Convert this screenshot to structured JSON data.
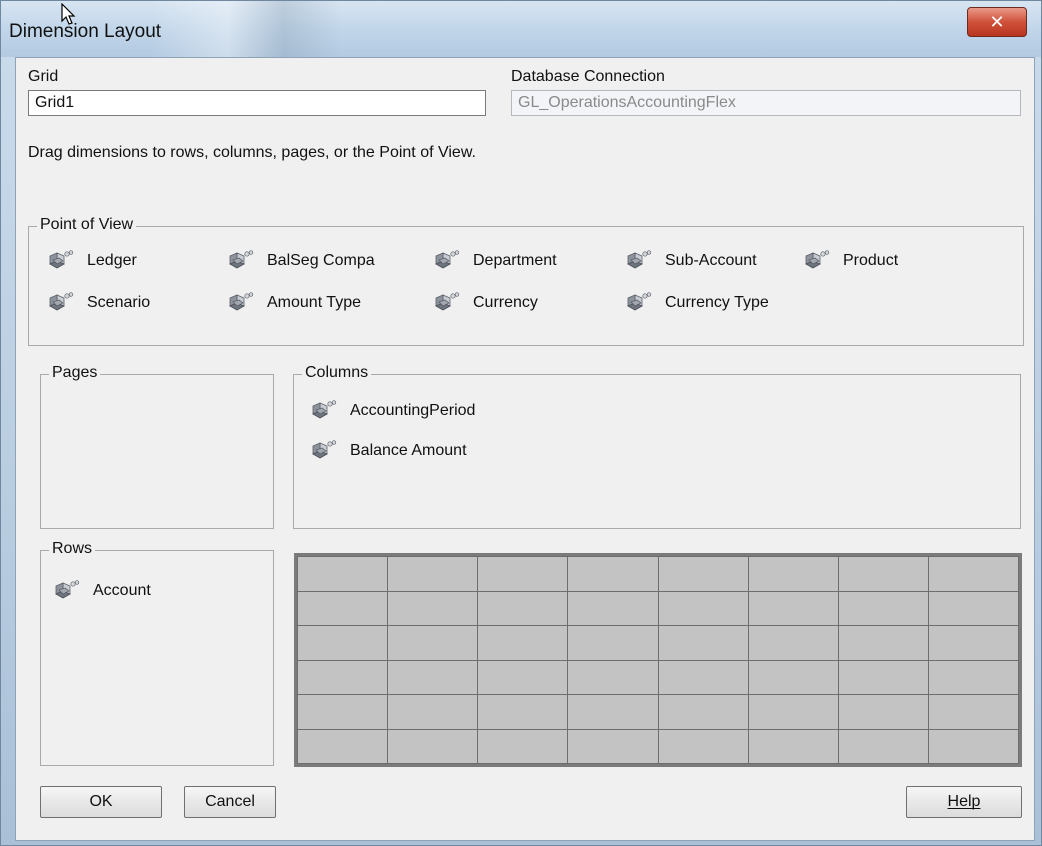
{
  "window": {
    "title": "Dimension Layout",
    "close_glyph": "✕"
  },
  "grid": {
    "label": "Grid",
    "value": "Grid1"
  },
  "database": {
    "label": "Database Connection",
    "value": "GL_OperationsAccountingFlex"
  },
  "instructions": "Drag dimensions to rows, columns, pages, or the Point of View.",
  "point_of_view": {
    "title": "Point of View",
    "items": [
      {
        "label": "Ledger",
        "icon": "dimension-cube-icon"
      },
      {
        "label": "BalSeg Compa",
        "icon": "dimension-cube-icon"
      },
      {
        "label": "Department",
        "icon": "dimension-cube-icon"
      },
      {
        "label": "Sub-Account",
        "icon": "dimension-cube-icon"
      },
      {
        "label": "Product",
        "icon": "dimension-cube-icon"
      },
      {
        "label": "Scenario",
        "icon": "dimension-cube-icon"
      },
      {
        "label": "Amount Type",
        "icon": "dimension-cube-icon"
      },
      {
        "label": "Currency",
        "icon": "dimension-cube-icon"
      },
      {
        "label": "Currency Type",
        "icon": "dimension-cube-icon"
      }
    ]
  },
  "pages": {
    "title": "Pages",
    "items": []
  },
  "columns": {
    "title": "Columns",
    "items": [
      {
        "label": "AccountingPeriod",
        "icon": "dimension-cube-icon"
      },
      {
        "label": "Balance Amount",
        "icon": "dimension-cube-icon"
      }
    ]
  },
  "rows": {
    "title": "Rows",
    "items": [
      {
        "label": "Account",
        "icon": "dimension-cube-icon"
      }
    ]
  },
  "preview_grid": {
    "rows": 6,
    "cols": 8
  },
  "buttons": {
    "ok": "OK",
    "cancel": "Cancel",
    "help": "Help"
  }
}
